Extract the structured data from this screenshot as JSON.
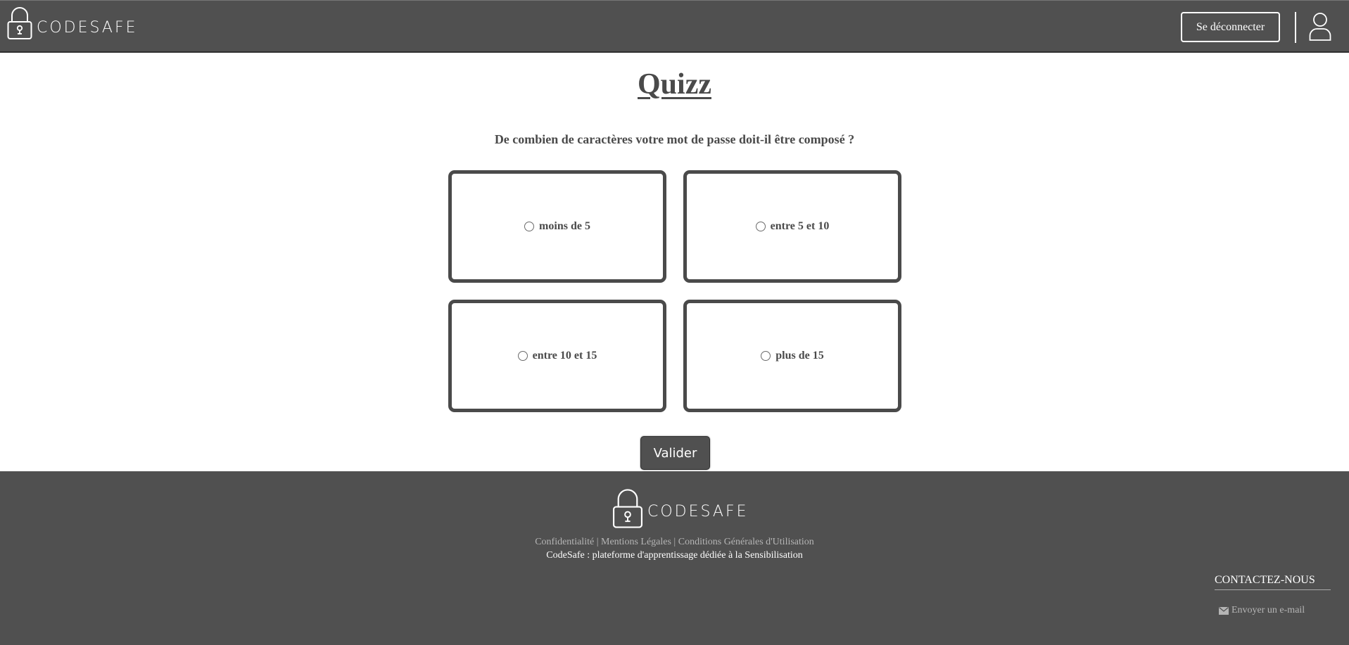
{
  "header": {
    "brand": "CODESAFE",
    "logout_label": "Se déconnecter",
    "user_icon": "user-icon",
    "lock_icon": "padlock-icon"
  },
  "quiz": {
    "title": "Quizz",
    "question": "De combien de caractères votre mot de passe doit-il être composé ?",
    "options": [
      {
        "label": "moins de 5",
        "selected": false
      },
      {
        "label": "entre 5 et 10",
        "selected": false
      },
      {
        "label": "entre 10 et 15",
        "selected": false
      },
      {
        "label": "plus de 15",
        "selected": false
      }
    ],
    "submit_label": "Valider"
  },
  "footer": {
    "brand": "CODESAFE",
    "links": [
      "Confidentialité",
      "Mentions Légales",
      "Conditions Générales d'Utilisation"
    ],
    "separator": " | ",
    "tagline": "CodeSafe : plateforme d'apprentissage dédiée à la Sensibilisation",
    "contact_title": "CONTACTEZ-NOUS",
    "contact_email_label": "Envoyer un e-mail",
    "mail_icon": "envelope-icon"
  },
  "colors": {
    "header_bg": "#505050",
    "footer_bg": "#505050",
    "text_dark": "#4a4a4a",
    "link_gray": "#b5b5b5"
  }
}
